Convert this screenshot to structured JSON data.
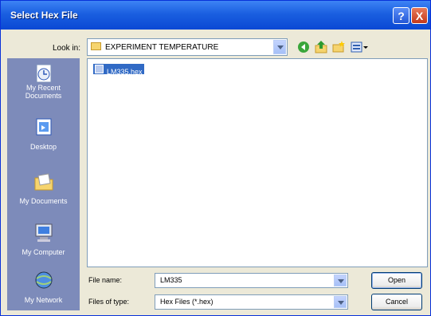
{
  "window": {
    "title": "Select Hex File",
    "help_glyph": "?",
    "close_glyph": "X"
  },
  "lookin": {
    "label": "Look in:",
    "value": "EXPERIMENT TEMPERATURE"
  },
  "toolbar": [
    "back-icon",
    "up-folder-icon",
    "new-folder-icon",
    "view-menu-icon"
  ],
  "places": [
    {
      "label_line1": "My Recent",
      "label_line2": "Documents",
      "icon": "recent-documents-icon"
    },
    {
      "label_line1": "Desktop",
      "label_line2": "",
      "icon": "desktop-icon"
    },
    {
      "label_line1": "My Documents",
      "label_line2": "",
      "icon": "my-documents-icon"
    },
    {
      "label_line1": "My Computer",
      "label_line2": "",
      "icon": "my-computer-icon"
    },
    {
      "label_line1": "My Network",
      "label_line2": "",
      "icon": "my-network-icon"
    }
  ],
  "files": [
    {
      "name": "LM335.hex",
      "selected": true
    }
  ],
  "filename": {
    "label": "File name:",
    "value": "LM335"
  },
  "filetype": {
    "label": "Files of type:",
    "value": "Hex Files (*.hex)"
  },
  "buttons": {
    "open": "Open",
    "cancel": "Cancel"
  },
  "colors": {
    "titlebar": "#0a48d4",
    "selection": "#316ac5",
    "places_bar": "#7d8bba",
    "dialog_bg": "#ece9d8"
  }
}
